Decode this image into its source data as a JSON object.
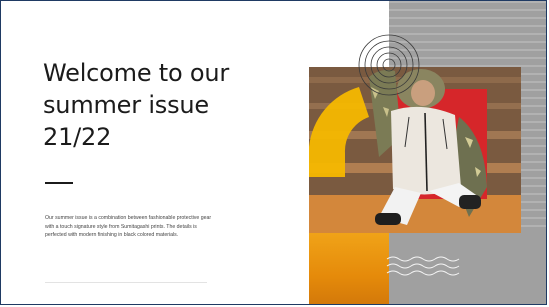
{
  "headline": {
    "line1": "Welcome to our",
    "line2": "summer issue",
    "line3": "21/22"
  },
  "body_text": "Our summer issue is a combination between fashionable protective gear with a touch signature style from Sumitagashi prints. The details is perfected with modern finishing in black colored materials.",
  "colors": {
    "accent_yellow": "#f5b800",
    "accent_orange": "#e58a0a",
    "accent_red": "#d6262a",
    "panel_gray": "#a9a9a9",
    "text_dark": "#1b1b1b"
  },
  "graphics": {
    "concentric_circles": "decorative-concentric-circles",
    "yellow_arch": "decorative-yellow-arch",
    "wave_lines": "decorative-wave-lines",
    "photo": "model-in-protective-jacket-photo"
  }
}
